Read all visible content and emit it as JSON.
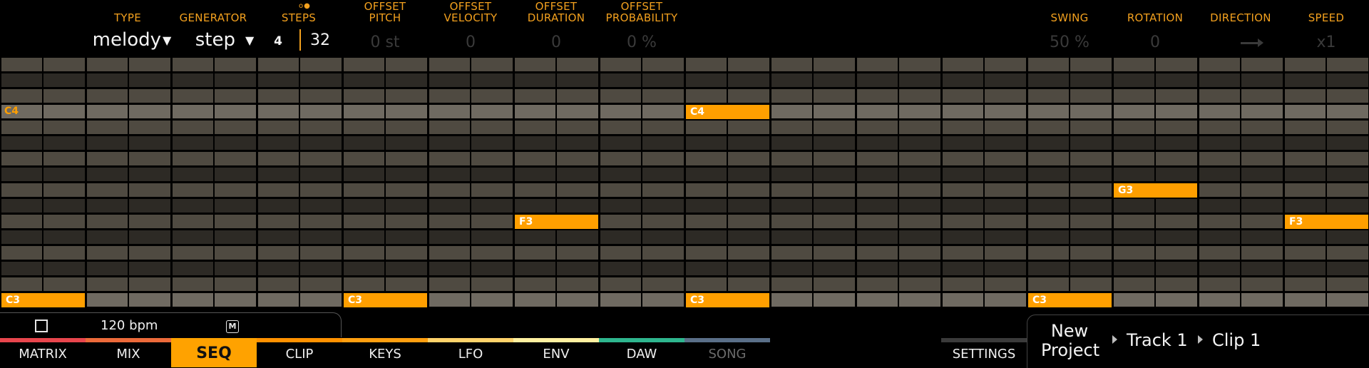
{
  "header": {
    "type": {
      "label": "TYPE",
      "value": "melody"
    },
    "generator": {
      "label": "GENERATOR",
      "value": "step"
    },
    "steps": {
      "label": "STEPS",
      "dots": "o●",
      "beats": "4",
      "count": "32"
    },
    "offset_pitch": {
      "label1": "OFFSET",
      "label2": "PITCH",
      "value": "0 st"
    },
    "offset_velocity": {
      "label1": "OFFSET",
      "label2": "VELOCITY",
      "value": "0"
    },
    "offset_duration": {
      "label1": "OFFSET",
      "label2": "DURATION",
      "value": "0"
    },
    "offset_probability": {
      "label1": "OFFSET",
      "label2": "PROBABILITY",
      "value": "0 %"
    },
    "swing": {
      "label": "SWING",
      "value": "50 %"
    },
    "rotation": {
      "label": "ROTATION",
      "value": "0"
    },
    "direction": {
      "label": "DIRECTION",
      "icon": "arrow-right-icon"
    },
    "speed": {
      "label": "SPEED",
      "value": "x1"
    }
  },
  "grid": {
    "steps": 32,
    "rows": 16,
    "row_label": "C4",
    "notes": [
      {
        "step": 0,
        "row": 15,
        "label": "C3"
      },
      {
        "step": 8,
        "row": 15,
        "label": "C3"
      },
      {
        "step": 16,
        "row": 3,
        "label": "C4"
      },
      {
        "step": 16,
        "row": 15,
        "label": "C3"
      },
      {
        "step": 24,
        "row": 15,
        "label": "C3"
      },
      {
        "step": 12,
        "row": 10,
        "label": "F3"
      },
      {
        "step": 26,
        "row": 8,
        "label": "G3"
      },
      {
        "step": 30,
        "row": 10,
        "label": "F3"
      }
    ],
    "colors": {
      "dark": "#2d2a25",
      "mid": "#4f4a41",
      "light": "#6f6a61",
      "note": "#ff9f00",
      "line": "#000000"
    }
  },
  "transport": {
    "bpm": "120 bpm",
    "metronome": "M"
  },
  "tabs": [
    {
      "label": "MATRIX",
      "stripe": "#e8464d"
    },
    {
      "label": "MIX",
      "stripe": "#ec6a3a"
    },
    {
      "label": "SEQ",
      "stripe": "#ffa200",
      "active": true
    },
    {
      "label": "CLIP",
      "stripe": "#ff9100"
    },
    {
      "label": "KEYS",
      "stripe": "#ff9f10"
    },
    {
      "label": "LFO",
      "stripe": "#ffd36b"
    },
    {
      "label": "ENV",
      "stripe": "#fff0a0"
    },
    {
      "label": "DAW",
      "stripe": "#2eb58e"
    },
    {
      "label": "SONG",
      "stripe": "#5a6f88",
      "disabled": true
    }
  ],
  "settings": {
    "label": "SETTINGS"
  },
  "breadcrumb": {
    "project_line1": "New",
    "project_line2": "Project",
    "track": "Track 1",
    "clip": "Clip 1"
  }
}
